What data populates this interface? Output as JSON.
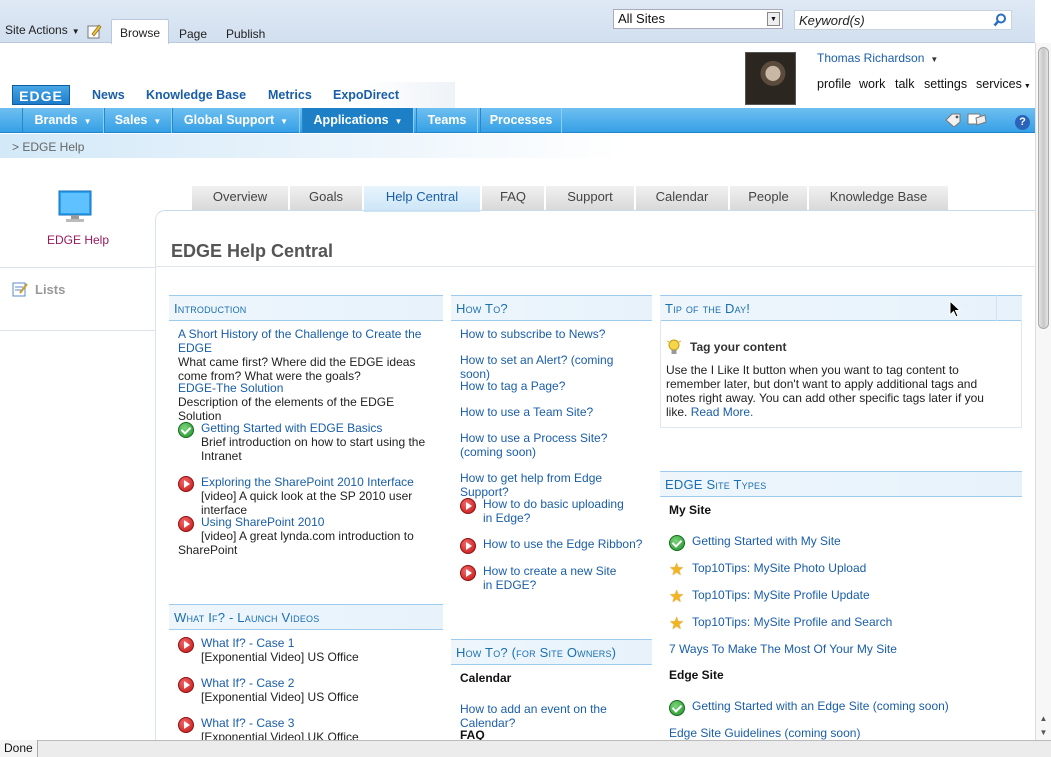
{
  "ribbon": {
    "site_actions": "Site Actions",
    "tabs": [
      "Browse",
      "Page",
      "Publish"
    ],
    "scope_value": "All Sites",
    "search_placeholder": "Keyword(s)"
  },
  "header": {
    "logo": "EDGE",
    "top_links": [
      "News",
      "Knowledge Base",
      "Metrics",
      "ExpoDirect"
    ],
    "user_name": "Thomas Richardson",
    "user_links": [
      "profile",
      "work",
      "talk",
      "settings",
      "services"
    ]
  },
  "nav": {
    "items": [
      "Brands",
      "Sales",
      "Global Support",
      "Applications",
      "Teams",
      "Processes"
    ]
  },
  "breadcrumb": "> EDGE Help",
  "left": {
    "site_label": "EDGE Help",
    "lists_label": "Lists"
  },
  "content_tabs": [
    "Overview",
    "Goals",
    "Help Central",
    "FAQ",
    "Support",
    "Calendar",
    "People",
    "Knowledge Base"
  ],
  "page_title": "EDGE Help Central",
  "introduction": {
    "heading": "Introduction",
    "items": [
      {
        "title": "A Short History of the Challenge to Create the EDGE",
        "desc": "What came first? Where did the EDGE ideas come from? What were the goals?"
      },
      {
        "title": "EDGE-The Solution",
        "desc": "Description of the elements of the EDGE Solution"
      },
      {
        "title": "Getting Started with EDGE Basics",
        "desc": "Brief introduction on how to start using the Intranet"
      },
      {
        "title": "Exploring the SharePoint 2010 Interface",
        "desc": "[video] A quick look at the SP 2010 user interface"
      },
      {
        "title": "Using SharePoint 2010",
        "desc": "[video] A great lynda.com introduction to SharePoint"
      }
    ]
  },
  "whatif": {
    "heading": "What If? - Launch Videos",
    "items": [
      {
        "title": "What If? - Case 1",
        "desc": "[Exponential Video] US Office"
      },
      {
        "title": "What If? - Case 2",
        "desc": "[Exponential Video] US Office"
      },
      {
        "title": "What If? - Case 3",
        "desc": "[Exponential Video] UK Office"
      }
    ]
  },
  "howto": {
    "heading": "How To?",
    "items": [
      "How to subscribe to News?",
      "How to set an Alert? (coming soon)",
      "How to tag a Page?",
      "How to use a Team Site?",
      "How to use a Process Site? (coming soon)",
      "How to get help from Edge Support?",
      "How to do basic uploading in Edge?",
      "How to use the Edge Ribbon?",
      "How to create a new Site in EDGE?"
    ]
  },
  "howto_owners": {
    "heading": "How To? (for Site Owners)",
    "calendar_heading": "Calendar",
    "calendar_item": "How to add an event on the Calendar?",
    "faq_heading": "FAQ"
  },
  "tip": {
    "heading": "Tip of the Day!",
    "title": "Tag your content",
    "body": "Use the I Like It button when you want to tag content to remember later, but don't want to apply additional tags and notes right away. You can add other specific tags later if you like.",
    "read_more": "Read More."
  },
  "site_types": {
    "heading": "EDGE Site Types",
    "my_site_heading": "My Site",
    "my_site_items": [
      "Getting Started with My Site",
      "Top10Tips: MySite Photo Upload",
      "Top10Tips: MySite Profile Update",
      "Top10Tips: MySite Profile and Search",
      "7 Ways To Make The Most Of Your My Site"
    ],
    "edge_site_heading": "Edge Site",
    "edge_site_items": [
      "Getting Started with an Edge Site (coming soon)",
      "Edge Site Guidelines (coming soon)"
    ]
  },
  "status": "Done",
  "colors": {
    "nav_blue": "#36a0e6",
    "link_blue": "#1a5ea8",
    "heading_blue": "#1a6fb1",
    "site_label_magenta": "#9c1a5c"
  }
}
